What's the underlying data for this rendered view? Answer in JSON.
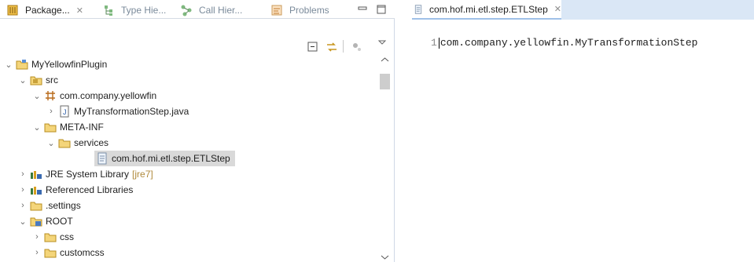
{
  "left_tabs": [
    {
      "label": "Package...",
      "icon": "package-explorer-icon"
    },
    {
      "label": "Type Hie...",
      "icon": "type-hierarchy-icon"
    },
    {
      "label": "Call Hier...",
      "icon": "call-hierarchy-icon"
    },
    {
      "label": "Problems",
      "icon": "problems-icon"
    }
  ],
  "close_glyph": "✕",
  "tree": [
    {
      "label": "MyYellowfinPlugin",
      "icon": "project-icon",
      "expanded": true
    },
    {
      "label": "src",
      "icon": "source-folder-icon",
      "expanded": true
    },
    {
      "label": "com.company.yellowfin",
      "icon": "package-icon",
      "expanded": true
    },
    {
      "label": "MyTransformationStep.java",
      "icon": "java-file-icon",
      "expanded": false
    },
    {
      "label": "META-INF",
      "icon": "folder-icon",
      "expanded": true
    },
    {
      "label": "services",
      "icon": "folder-icon",
      "expanded": true
    },
    {
      "label": "com.hof.mi.etl.step.ETLStep",
      "icon": "text-file-icon",
      "selected": true
    },
    {
      "label": "JRE System Library",
      "suffix": "[jre7]",
      "icon": "library-icon",
      "expanded": false
    },
    {
      "label": "Referenced Libraries",
      "icon": "library-icon",
      "expanded": false
    },
    {
      "label": ".settings",
      "icon": "folder-icon",
      "expanded": false
    },
    {
      "label": "ROOT",
      "icon": "root-folder-icon",
      "expanded": true
    },
    {
      "label": "css",
      "icon": "folder-icon",
      "expanded": false
    },
    {
      "label": "customcss",
      "icon": "folder-icon",
      "expanded": false
    }
  ],
  "editor": {
    "tab_label": "com.hof.mi.etl.step.ETLStep",
    "line_number": "1",
    "first_line": "com.company.yellowfin.MyTransformationStep"
  },
  "colors": {
    "accent": "#dae7f6",
    "selection": "#d9d9d9"
  }
}
